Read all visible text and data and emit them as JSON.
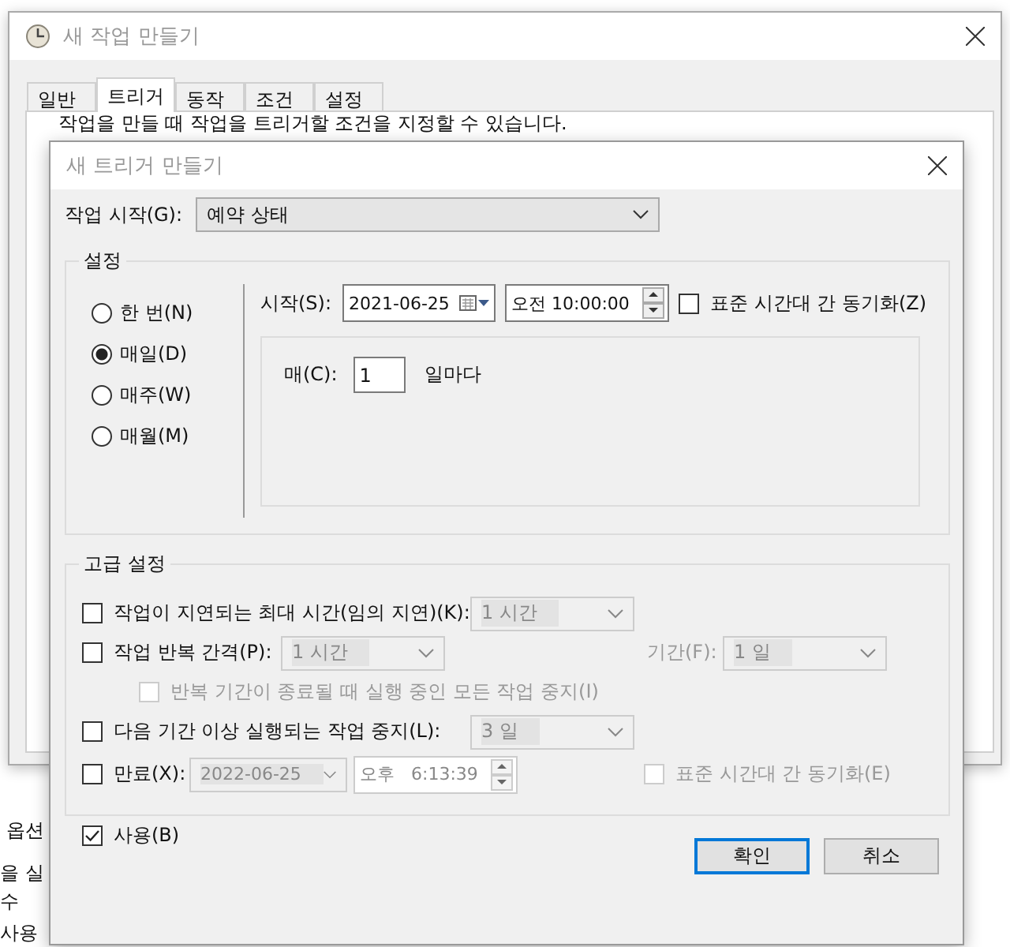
{
  "background": {
    "fragments": [
      "옵션",
      "을 실",
      "수",
      "사용"
    ]
  },
  "outer_window": {
    "title": "새 작업 만들기",
    "tabs": [
      {
        "label": "일반",
        "selected": false
      },
      {
        "label": "트리거",
        "selected": true
      },
      {
        "label": "동작",
        "selected": false
      },
      {
        "label": "조건",
        "selected": false
      },
      {
        "label": "설정",
        "selected": false
      }
    ],
    "description": "작업을 만들 때 작업을 트리거할 조건을 지정할 수 있습니다."
  },
  "dialog": {
    "title": "새 트리거 만들기",
    "begin_label": "작업 시작(G):",
    "begin_value": "예약 상태",
    "settings": {
      "legend": "설정",
      "schedule_options": [
        {
          "label": "한 번(N)",
          "selected": false
        },
        {
          "label": "매일(D)",
          "selected": true
        },
        {
          "label": "매주(W)",
          "selected": false
        },
        {
          "label": "매월(M)",
          "selected": false
        }
      ],
      "start_label": "시작(S):",
      "start_date": "2021-06-25",
      "start_time": "오전 10:00:00",
      "sync_timezone": {
        "label": "표준 시간대 간 동기화(Z)",
        "checked": false
      },
      "recur_label": "매(C):",
      "recur_value": "1",
      "recur_unit": "일마다"
    },
    "advanced": {
      "legend": "고급 설정",
      "delay": {
        "label": "작업이 지연되는 최대 시간(임의 지연)(K):",
        "checked": false,
        "value": "1 시간"
      },
      "repeat": {
        "label": "작업 반복 간격(P):",
        "checked": false,
        "value": "1 시간",
        "duration_label": "기간(F):",
        "duration_value": "1 일"
      },
      "stop_all": {
        "label": "반복 기간이 종료될 때 실행 중인 모든 작업 중지(I)",
        "checked": false,
        "disabled": true
      },
      "stop_longer": {
        "label": "다음 기간 이상 실행되는 작업 중지(L):",
        "checked": false,
        "value": "3 일"
      },
      "expire": {
        "label": "만료(X):",
        "checked": false,
        "date": "2022-06-25",
        "time": "오후   6:13:39",
        "sync": {
          "label": "표준 시간대 간 동기화(E)",
          "checked": false,
          "disabled": true
        }
      },
      "enabled": {
        "label": "사용(B)",
        "checked": true
      }
    },
    "buttons": [
      {
        "label": "확인",
        "kind": "default"
      },
      {
        "label": "취소",
        "kind": "normal"
      }
    ]
  }
}
